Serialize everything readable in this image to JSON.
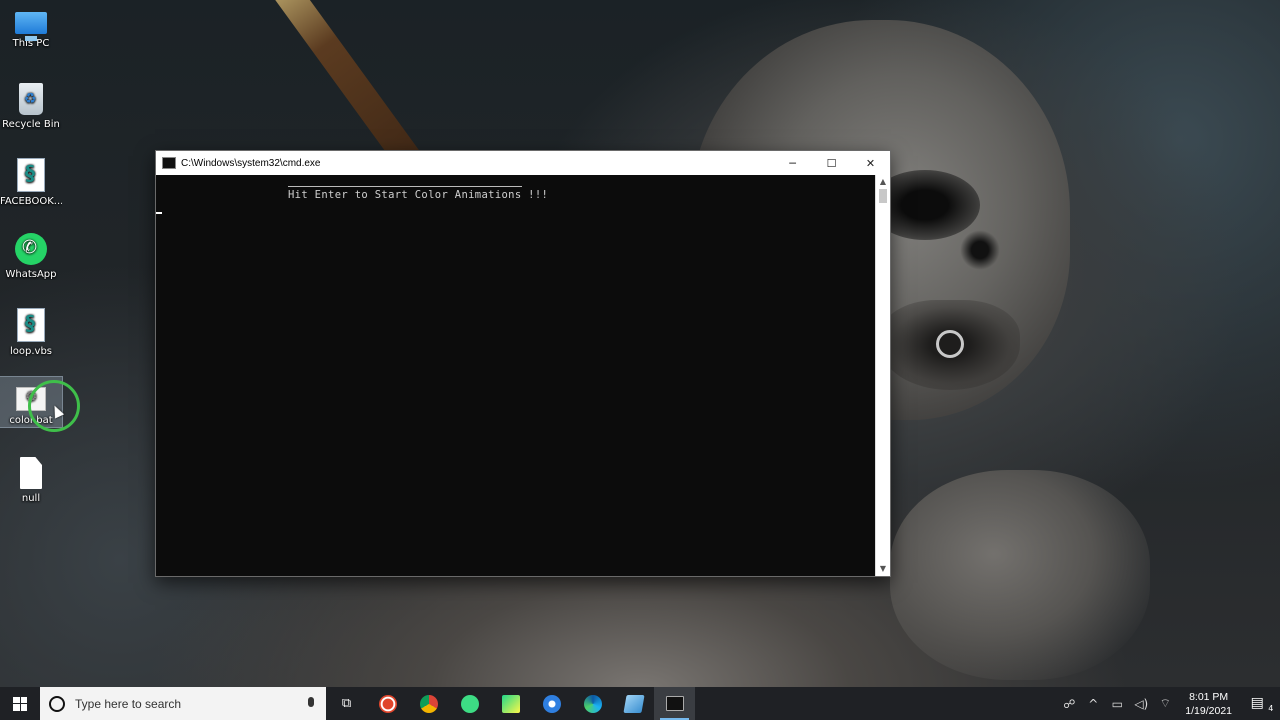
{
  "desktop": {
    "icons": [
      {
        "label": "This PC",
        "icon": "computer-icon"
      },
      {
        "label": "Recycle Bin",
        "icon": "recycle-bin-icon"
      },
      {
        "label": "FACEBOOK...",
        "icon": "vbs-script-icon"
      },
      {
        "label": "WhatsApp",
        "icon": "whatsapp-icon"
      },
      {
        "label": "loop.vbs",
        "icon": "vbs-script-icon"
      },
      {
        "label": "color.bat",
        "icon": "batch-file-icon"
      },
      {
        "label": "null",
        "icon": "blank-file-icon"
      }
    ]
  },
  "cmd_window": {
    "title": "C:\\Windows\\system32\\cmd.exe",
    "controls": {
      "minimize": "─",
      "maximize": "☐",
      "close": "✕"
    },
    "console_line": "Hit Enter to Start Color Animations !!!"
  },
  "taskbar": {
    "search_placeholder": "Type here to search",
    "apps": [
      "task-view-icon",
      "screen-recorder-icon",
      "chrome-icon",
      "android-studio-icon",
      "pycharm-icon",
      "app-icon",
      "edge-icon",
      "notepad-icon",
      "cmd-icon"
    ],
    "clock_time": "8:01 PM",
    "clock_date": "1/19/2021",
    "notification_count": "4"
  },
  "colors": {
    "taskbar": "#1f2125",
    "console_bg": "#0c0c0c",
    "click_ring": "#3fbf4a",
    "active_accent": "#76b9ed"
  }
}
